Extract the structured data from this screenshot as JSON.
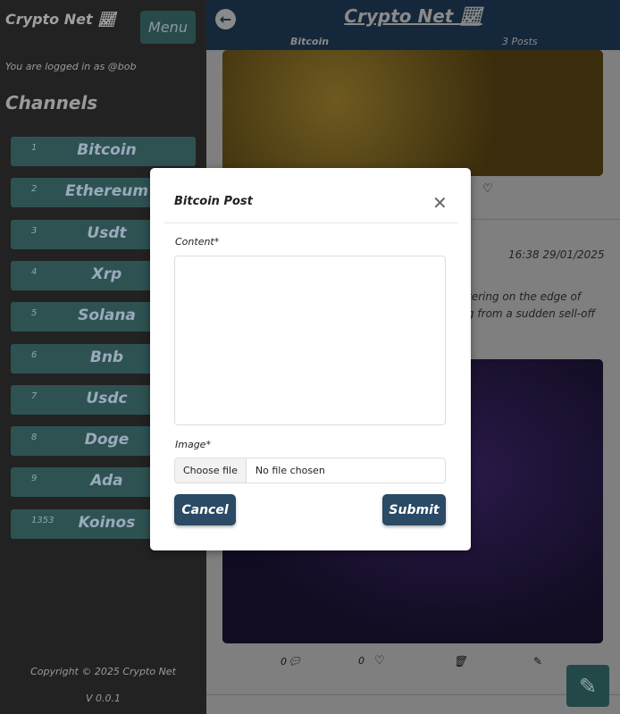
{
  "sidebar": {
    "brand": "Crypto Net",
    "menu_label": "Menu",
    "logged_in": "You are logged in as @bob",
    "channels_heading": "Channels",
    "channels": [
      {
        "num": "1",
        "name": "Bitcoin"
      },
      {
        "num": "2",
        "name": "Ethereum"
      },
      {
        "num": "3",
        "name": "Usdt"
      },
      {
        "num": "4",
        "name": "Xrp"
      },
      {
        "num": "5",
        "name": "Solana"
      },
      {
        "num": "6",
        "name": "Bnb"
      },
      {
        "num": "7",
        "name": "Usdc"
      },
      {
        "num": "8",
        "name": "Doge"
      },
      {
        "num": "9",
        "name": "Ada"
      },
      {
        "num": "1353",
        "name": "Koinos"
      }
    ],
    "copyright": "Copyright © 2025 Crypto Net",
    "version": "V 0.0.1"
  },
  "header": {
    "title": "Crypto Net",
    "channel": "Bitcoin",
    "post_count": "3 Posts"
  },
  "posts": [
    {
      "comments": "",
      "likes": ""
    },
    {
      "date": "16:38 29/01/2025",
      "text_line1": "tering on the edge of",
      "text_line2": "g from a sudden sell-off",
      "comments": "0",
      "likes": "0"
    }
  ],
  "modal": {
    "title": "Bitcoin Post",
    "content_label": "Content*",
    "content_value": "",
    "image_label": "Image*",
    "choose_file": "Choose file",
    "no_file": "No file chosen",
    "cancel": "Cancel",
    "submit": "Submit"
  }
}
